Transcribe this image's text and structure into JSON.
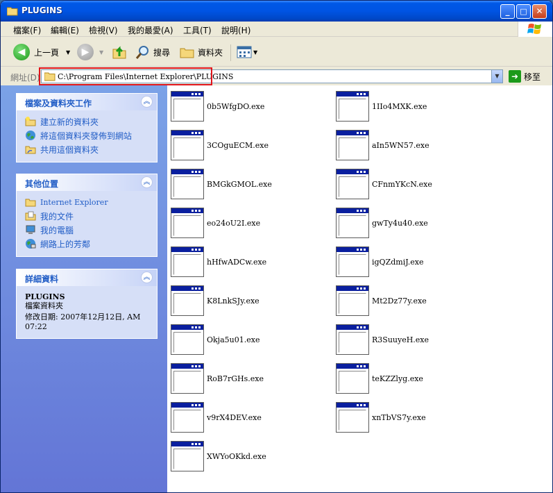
{
  "window": {
    "title": "PLUGINS",
    "controls": {
      "minimize": "_",
      "maximize": "□",
      "close": "✕"
    }
  },
  "menubar": {
    "items": [
      "檔案(F)",
      "編輯(E)",
      "檢視(V)",
      "我的最愛(A)",
      "工具(T)",
      "說明(H)"
    ]
  },
  "toolbar": {
    "back_label": "上一頁",
    "search_label": "搜尋",
    "folders_label": "資料夾"
  },
  "address": {
    "label": "網址(D)",
    "path": "C:\\Program Files\\Internet Explorer\\PLUGINS",
    "go_label": "移至"
  },
  "taskpane": {
    "file_tasks": {
      "title": "檔案及資料夾工作",
      "items": [
        "建立新的資料夾",
        "將這個資料夾發佈到網站",
        "共用這個資料夾"
      ]
    },
    "other_places": {
      "title": "其他位置",
      "items": [
        "Internet Explorer",
        "我的文件",
        "我的電腦",
        "網路上的芳鄰"
      ]
    },
    "details": {
      "title": "詳細資料",
      "name": "PLUGINS",
      "type": "檔案資料夾",
      "modified": "修改日期: 2007年12月12日, AM 07:22"
    }
  },
  "files": [
    "0b5WfgDO.exe",
    "1IIo4MXK.exe",
    "3COguECM.exe",
    "aIn5WN57.exe",
    "BMGkGMOL.exe",
    "CFnmYKcN.exe",
    "eo24oU2I.exe",
    "gwTy4u40.exe",
    "hHfwADCw.exe",
    "igQZdmiJ.exe",
    "K8LnkSJy.exe",
    "Mt2Dz77y.exe",
    "Okja5u01.exe",
    "R3SuuyeH.exe",
    "RoB7rGHs.exe",
    "teKZZlyg.exe",
    "v9rX4DEV.exe",
    "xnTbVS7y.exe",
    "XWYoOKkd.exe"
  ],
  "colors": {
    "titlebar": "#0054e3",
    "taskpane": "#7ba2e7",
    "panel_link": "#215dc6",
    "address_highlight": "#e0151b"
  }
}
